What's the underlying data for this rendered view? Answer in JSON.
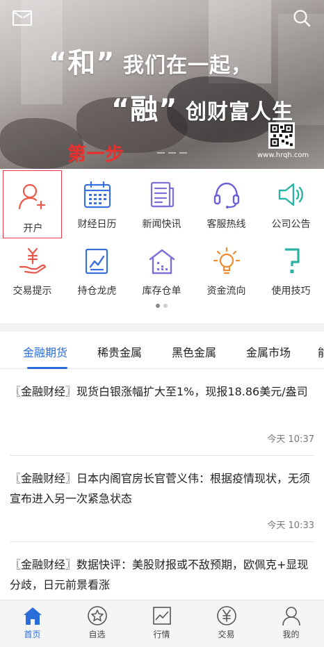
{
  "banner": {
    "slogan_line1_word": "和",
    "slogan_line1_rest": "我们在一起，",
    "slogan_line2_word": "融",
    "slogan_line2_rest": "创财富人生",
    "website": "www.hrqh.com",
    "step_label": "第一步"
  },
  "grid": {
    "items": [
      {
        "label": "开户",
        "icon": "user-add-icon"
      },
      {
        "label": "财经日历",
        "icon": "calendar-icon"
      },
      {
        "label": "新闻快讯",
        "icon": "news-icon"
      },
      {
        "label": "客服热线",
        "icon": "headset-icon"
      },
      {
        "label": "公司公告",
        "icon": "speaker-icon"
      },
      {
        "label": "交易提示",
        "icon": "yen-hand-icon"
      },
      {
        "label": "持仓龙虎",
        "icon": "chart-doc-icon"
      },
      {
        "label": "库存仓单",
        "icon": "warehouse-icon"
      },
      {
        "label": "资金流向",
        "icon": "bulb-icon"
      },
      {
        "label": "使用技巧",
        "icon": "question-icon"
      }
    ]
  },
  "tabs": [
    "金融期货",
    "稀贵金属",
    "黑色金属",
    "金属市场",
    "能"
  ],
  "news": [
    {
      "title": "〖金融财经〗现货白银涨幅扩大至1%，现报18.86美元/盎司",
      "time": "今天 10:37"
    },
    {
      "title": "〖金融财经〗日本内阁官房长官菅义伟：根据疫情现状，无须宣布进入另一次紧急状态",
      "time": "今天 10:33"
    },
    {
      "title": "〖金融财经〗数据快评：美股财报或不敌预期，欧佩克+显现分歧，日元前景看涨",
      "time": ""
    }
  ],
  "bottom_nav": [
    {
      "label": "首页",
      "icon": "home-icon"
    },
    {
      "label": "自选",
      "icon": "star-icon"
    },
    {
      "label": "行情",
      "icon": "market-chart-icon"
    },
    {
      "label": "交易",
      "icon": "yen-circle-icon"
    },
    {
      "label": "我的",
      "icon": "profile-icon"
    }
  ],
  "colors": {
    "accent": "#2b6dd8",
    "highlight": "#e83a4a",
    "step_red": "#e8312f"
  }
}
